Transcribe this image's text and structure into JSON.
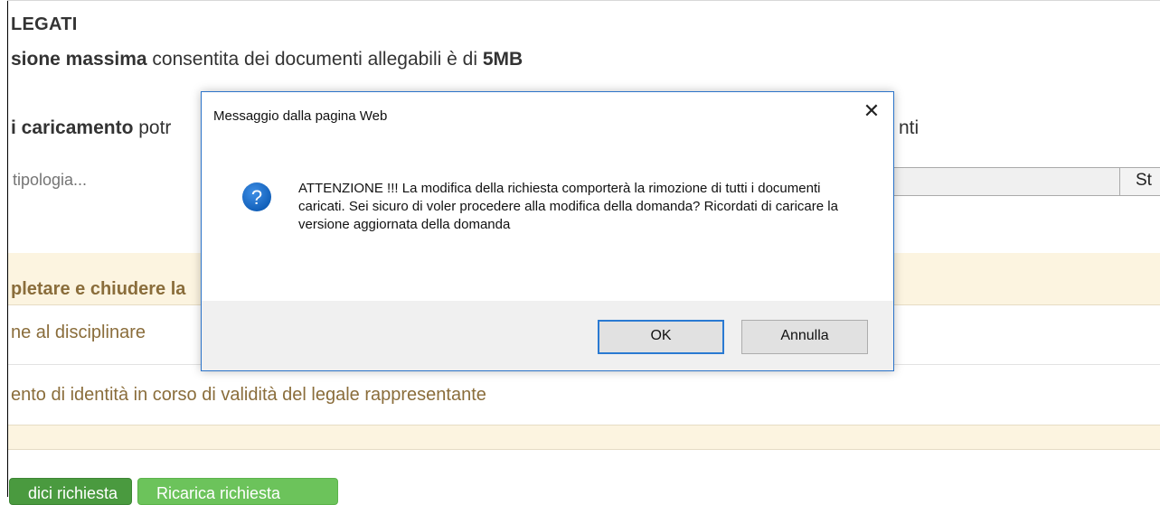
{
  "page": {
    "section_title": "LEGATI",
    "size_line": {
      "bold_start": "sione massima",
      "middle": " consentita dei documenti allegabili è di ",
      "bold_end": "5MB"
    },
    "upload_line": {
      "bold_start": "i caricamento",
      "rest": " potr",
      "end_fragment": "nti"
    },
    "type_input_placeholder": "tipologia...",
    "browse_button_label": "St",
    "notice_band_text": "pletare e chiudere la",
    "document_items": [
      "ne al disciplinare",
      "ento di identità in corso di validità del legale rappresentante"
    ],
    "buttons": {
      "green_primary": "dici richiesta",
      "green_secondary": "Ricarica richiesta"
    }
  },
  "dialog": {
    "title": "Messaggio dalla pagina Web",
    "close_glyph": "✕",
    "icon": "question-icon",
    "message": "ATTENZIONE !!! La modifica della richiesta comporterà la rimozione di tutti i documenti caricati. Sei sicuro di voler procedere alla modifica della domanda? Ricordati di caricare la versione aggiornata della domanda",
    "ok_label": "OK",
    "cancel_label": "Annulla"
  },
  "colors": {
    "accent_blue": "#2b73c9",
    "band_background": "#fcf4e0",
    "band_text": "#8a6d3b",
    "green_dark": "#4a9a3f",
    "green_light": "#6cc35b"
  }
}
